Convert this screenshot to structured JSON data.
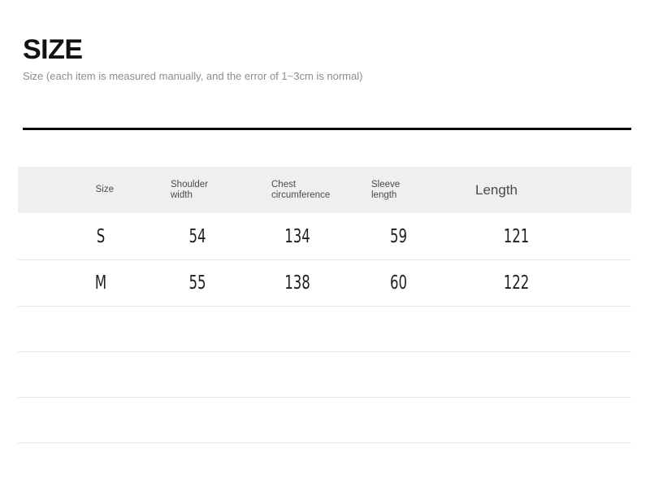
{
  "header": {
    "title": "SIZE",
    "subtitle": "Size (each item is measured manually, and the error of 1~3cm is normal)"
  },
  "colors": {
    "rule": "#0a0a0a",
    "header_band": "#efefef",
    "divider": "#e9e9e9",
    "subtitle_text": "#8d8d8d",
    "header_text": "#4a4a4a",
    "value_text": "#1f1f1f"
  },
  "table": {
    "columns": [
      {
        "key": "size",
        "label": "Size"
      },
      {
        "key": "shoulder",
        "label": "Shoulder\nwidth"
      },
      {
        "key": "chest",
        "label": "Chest\ncircumference"
      },
      {
        "key": "sleeve",
        "label": "Sleeve\nlength"
      },
      {
        "key": "length",
        "label": "Length"
      }
    ],
    "rows": [
      {
        "size": "S",
        "shoulder": "54",
        "chest": "134",
        "sleeve": "59",
        "length": "121"
      },
      {
        "size": "M",
        "shoulder": "55",
        "chest": "138",
        "sleeve": "60",
        "length": "122"
      }
    ],
    "empty_row_count": 4
  }
}
